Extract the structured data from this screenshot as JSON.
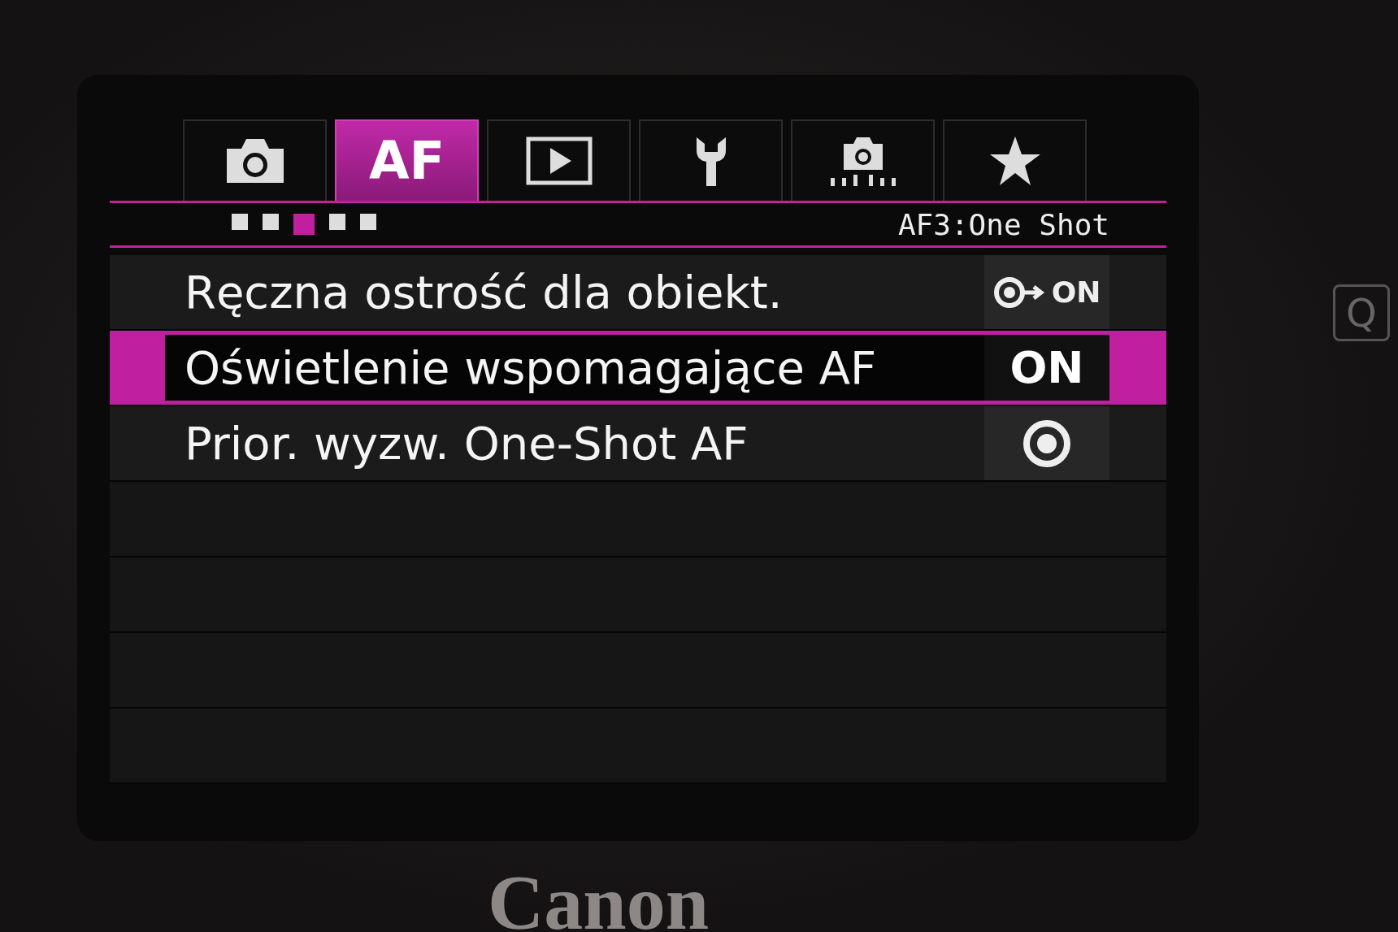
{
  "tabs": [
    {
      "kind": "camera",
      "selected": false
    },
    {
      "kind": "text",
      "label": "AF",
      "selected": true
    },
    {
      "kind": "play",
      "selected": false
    },
    {
      "kind": "wrench",
      "selected": false
    },
    {
      "kind": "live-camera",
      "selected": false
    },
    {
      "kind": "star",
      "selected": false
    }
  ],
  "page_dots": [
    {
      "selected": false
    },
    {
      "selected": false
    },
    {
      "selected": true
    },
    {
      "selected": false
    },
    {
      "selected": false
    }
  ],
  "page_title": "AF3:One Shot",
  "items": [
    {
      "label": "Ręczna ostrość dla obiekt.",
      "kind": "focus-arrow",
      "value": "ON",
      "selected": false
    },
    {
      "label": "Oświetlenie wspomagające AF",
      "kind": "text",
      "value": "ON",
      "selected": true
    },
    {
      "label": "Prior. wyzw. One-Shot AF",
      "kind": "focus",
      "selected": false
    }
  ],
  "bezel": {
    "button": "Q",
    "brand": "Canon"
  }
}
